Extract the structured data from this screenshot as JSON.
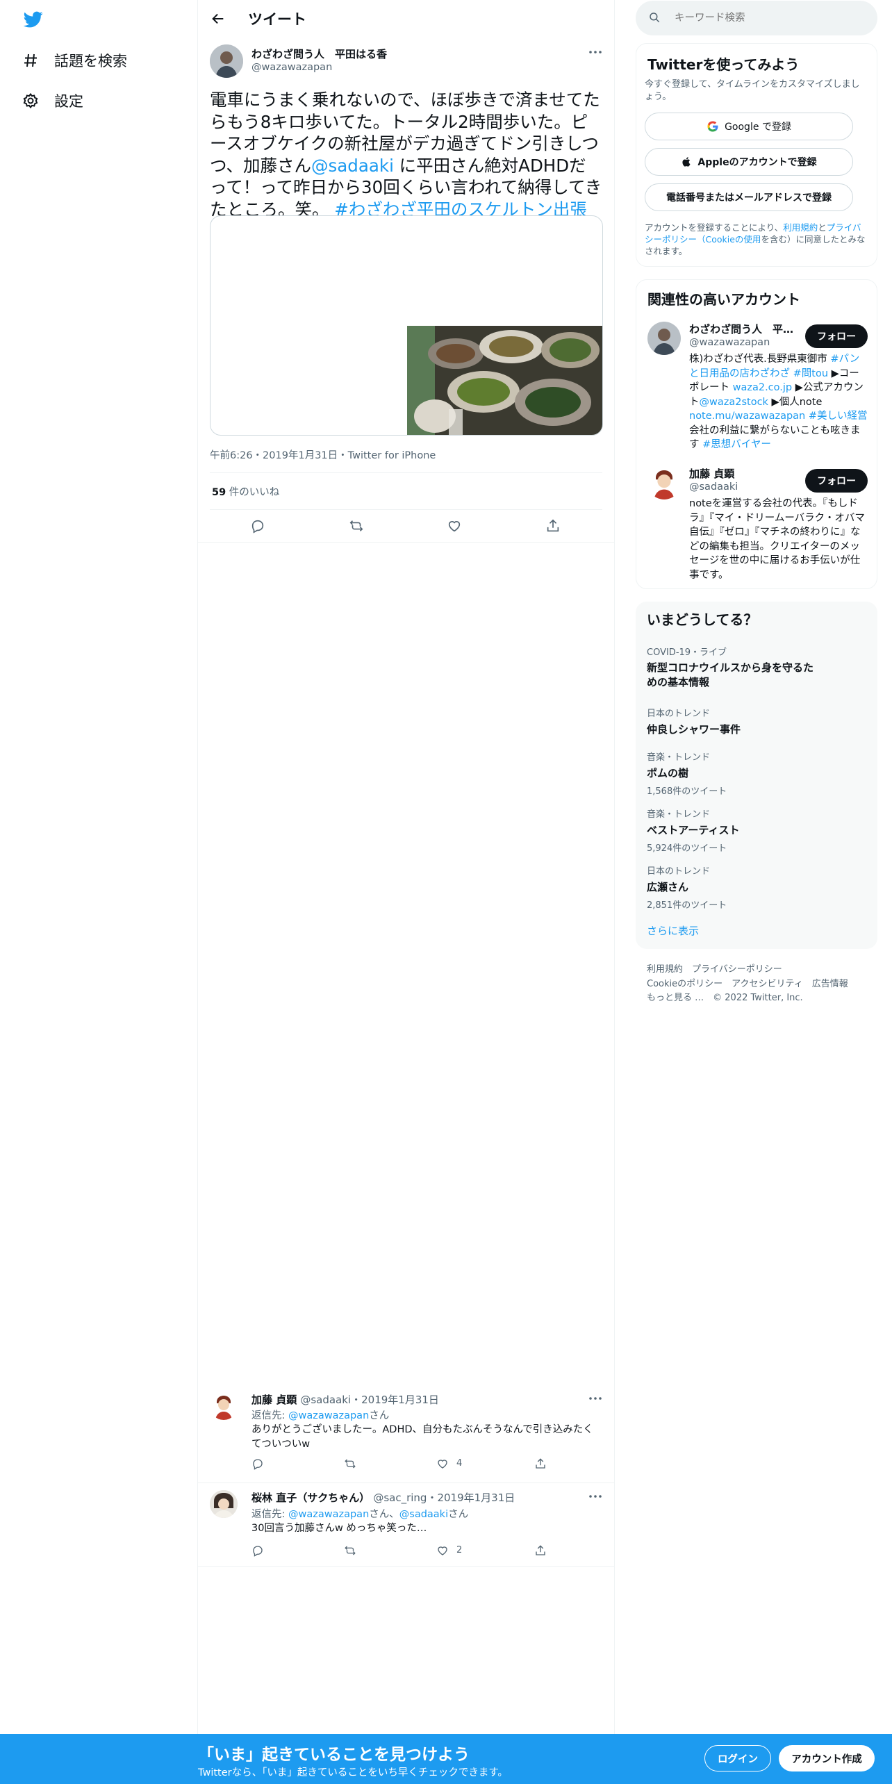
{
  "nav": {
    "explore_label": "話題を検索",
    "settings_label": "設定"
  },
  "header": {
    "title": "ツイート"
  },
  "tweet": {
    "author_name": "わざわざ問う人　平田はる香",
    "author_handle": "@wazawazapan",
    "text_part1": "電車にうまく乗れないので、ほぼ歩きで済ませてたらもう8キロ歩いてた。トータル2時間歩いた。ピースオブケイクの新社屋がデカ過ぎてドン引きしつつ、加藤さん",
    "mention": "@sadaaki",
    "text_part2": " に平田さん絶対ADHDだって！って昨日から30回くらい言われて納得してきたところ。笑。 ",
    "hashtag": "#わざわざ平田のスケルトン出張",
    "meta": "午前6:26・2019年1月31日・Twitter for iPhone",
    "likes_count": "59",
    "likes_label": " 件のいいね"
  },
  "replies": [
    {
      "name": "加藤 貞顕",
      "handle": "@sadaaki",
      "date": "・2019年1月31日",
      "reply_to_prefix": "返信先: ",
      "reply_to_1": "@wazawazapan",
      "reply_to_sep": "",
      "reply_to_2": "",
      "reply_to_suffix": "さん",
      "text": "ありがとうございましたー。ADHD、自分もたぶんそうなんで引き込みたくてついついw",
      "like_count": "4"
    },
    {
      "name": "桜林 直子（サクちゃん）",
      "handle": "@sac_ring",
      "date": "・2019年1月31日",
      "reply_to_prefix": "返信先: ",
      "reply_to_1": "@wazawazapan",
      "reply_to_sep": "さん、",
      "reply_to_2": "@sadaaki",
      "reply_to_suffix": "さん",
      "text": "30回言う加藤さんw めっちゃ笑った…",
      "like_count": "2"
    }
  ],
  "search": {
    "placeholder": "キーワード検索"
  },
  "signup": {
    "title": "Twitterを使ってみよう",
    "subtitle": "今すぐ登録して、タイムラインをカスタマイズしましょう。",
    "google_label": "Google で登録",
    "apple_label": "Appleのアカウントで登録",
    "phone_label": "電話番号またはメールアドレスで登録",
    "terms_prefix": "アカウントを登録することにより、",
    "terms_link1": "利用規約",
    "terms_and": "と",
    "terms_link2": "プライバシーポリシー（Cookieの使用",
    "terms_suffix": "を含む）に同意したとみなされます。"
  },
  "related": {
    "title": "関連性の高いアカウント",
    "follow_label": "フォロー",
    "accounts": [
      {
        "name": "わざわざ問う人　平…",
        "handle": "@wazawazapan",
        "bio_1": "株)わざわざ代表.長野県東御市 ",
        "bio_2": "#パンと日用品の店わざわざ",
        "bio_3": " ",
        "bio_4": "#問tou",
        "bio_5": " ▶コーポレート ",
        "bio_6": "waza2.co.jp",
        "bio_7": " ▶公式アカウント",
        "bio_8": "@waza2stock",
        "bio_9": " ▶個人note ",
        "bio_10": "note.mu/wazawazapan",
        "bio_11": " ",
        "bio_12": "#美しい経営",
        "bio_13": " 会社の利益に繋がらないことも呟きます ",
        "bio_14": "#思想バイヤー"
      },
      {
        "name": "加藤 貞顕",
        "handle": "@sadaaki",
        "bio": "noteを運営する会社の代表。『もしドラ』『マイ・ドリームーバラク・オバマ自伝』『ゼロ』『マチネの終わりに』などの編集も担当。クリエイターのメッセージを世の中に届けるお手伝いが仕事です。"
      }
    ]
  },
  "trends": {
    "title": "いまどうしてる？",
    "items": [
      {
        "category": "COVID-19・ライブ",
        "name": "新型コロナウイルスから身を守るための基本情報",
        "count": ""
      },
      {
        "category": "日本のトレンド",
        "name": "仲良しシャワー事件",
        "count": ""
      },
      {
        "category": "音楽・トレンド",
        "name": "ポムの樹",
        "count": "1,568件のツイート"
      },
      {
        "category": "音楽・トレンド",
        "name": "ベストアーティスト",
        "count": "5,924件のツイート"
      },
      {
        "category": "日本のトレンド",
        "name": "広瀬さん",
        "count": "2,851件のツイート"
      }
    ],
    "show_more": "さらに表示"
  },
  "footer": {
    "terms": "利用規約",
    "privacy": "プライバシーポリシー",
    "cookie": "Cookieのポリシー",
    "accessibility": "アクセシビリティ",
    "ads": "広告情報",
    "more": "もっと見る …",
    "copyright": "© 2022 Twitter, Inc."
  },
  "bottombar": {
    "title": "「いま」起きていることを見つけよう",
    "subtitle": "Twitterなら、「いま」起きていることをいち早くチェックできます。",
    "login_label": "ログイン",
    "signup_label": "アカウント作成"
  },
  "colors": {
    "accent": "#1d9bf0",
    "text": "#0f1419",
    "secondary": "#536471"
  }
}
